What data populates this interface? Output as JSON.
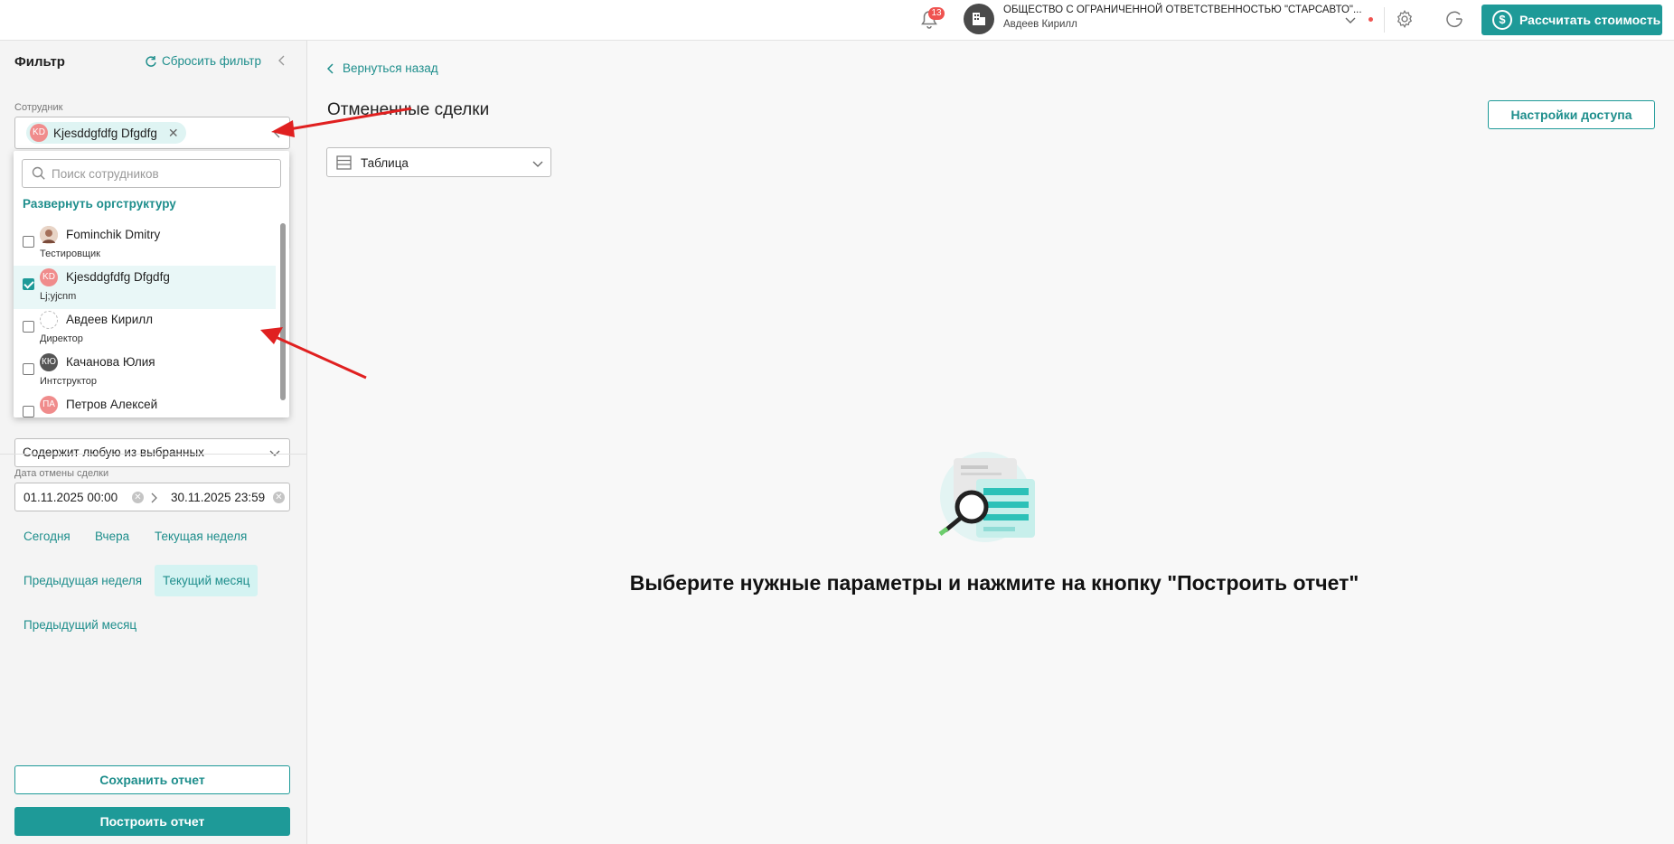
{
  "header": {
    "notifications_count": "13",
    "org_name": "ОБЩЕСТВО С ОГРАНИЧЕННОЙ ОТВЕТСТВЕННОСТЬЮ \"СТАРСАВТО\"...",
    "user_name": "Авдеев Кирилл",
    "calc_button": "Рассчитать стоимость",
    "accent_color": "#1e9a98"
  },
  "filter": {
    "title": "Фильтр",
    "reset_label": "Сбросить фильтр",
    "employee_label": "Сотрудник",
    "selected_chip": {
      "initials": "KD",
      "name": "Kjesddgfdfg Dfgdfg"
    },
    "contains_value": "Содержит любую из выбранных",
    "date_label": "Дата отмены сделки",
    "date_from": "01.11.2025 00:00",
    "date_to": "30.11.2025 23:59",
    "periods": [
      "Сегодня",
      "Вчера",
      "Текущая неделя",
      "Предыдущая неделя",
      "Текущий месяц",
      "Предыдущий месяц"
    ],
    "active_period": "Текущий месяц",
    "save_button": "Сохранить отчет",
    "build_button": "Построить отчет"
  },
  "employee_dropdown": {
    "search_placeholder": "Поиск сотрудников",
    "expand_link": "Развернуть оргструктуру",
    "employees": [
      {
        "name": "Fominchik Dmitry",
        "position": "Тестировщик",
        "initials": "",
        "checked": false
      },
      {
        "name": "Kjesddgfdfg Dfgdfg",
        "position": "Lj;yjcnm",
        "initials": "KD",
        "checked": true
      },
      {
        "name": "Авдеев Кирилл",
        "position": "Директор",
        "initials": "",
        "checked": false
      },
      {
        "name": "Качанова Юлия",
        "position": "Интструктор",
        "initials": "КЮ",
        "checked": false
      },
      {
        "name": "Петров Алексей",
        "position": "",
        "initials": "ПА",
        "checked": false
      }
    ]
  },
  "main": {
    "back_link": "Вернуться назад",
    "page_title": "Отмененные сделки",
    "access_button": "Настройки доступа",
    "view_select": "Таблица",
    "empty_message": "Выберите нужные параметры и нажмите на кнопку \"Построить отчет\""
  }
}
